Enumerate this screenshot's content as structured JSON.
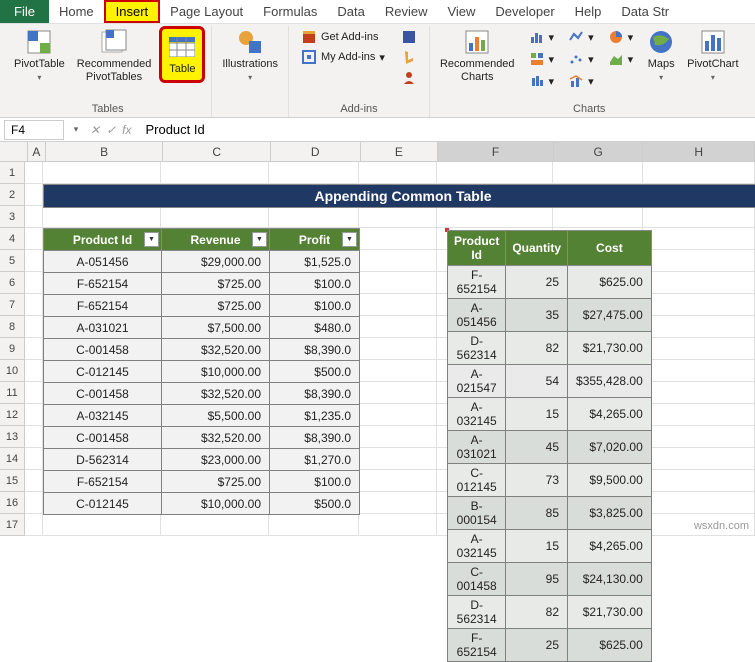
{
  "tabs": {
    "file": "File",
    "home": "Home",
    "insert": "Insert",
    "page_layout": "Page Layout",
    "formulas": "Formulas",
    "data": "Data",
    "review": "Review",
    "view": "View",
    "developer": "Developer",
    "help": "Help",
    "data_str": "Data Str"
  },
  "ribbon": {
    "pivot": "PivotTable",
    "recommended_pivot": "Recommended\nPivotTables",
    "table": "Table",
    "illustrations": "Illustrations",
    "get_addins": "Get Add-ins",
    "my_addins": "My Add-ins",
    "recommended_charts": "Recommended\nCharts",
    "maps": "Maps",
    "pivotchart": "PivotChart",
    "group_tables": "Tables",
    "group_addins": "Add-ins",
    "group_charts": "Charts"
  },
  "formula": {
    "cell_ref": "F4",
    "value": "Product Id"
  },
  "cols": [
    "A",
    "B",
    "C",
    "D",
    "E",
    "F",
    "G",
    "H"
  ],
  "rows": [
    "1",
    "2",
    "3",
    "4",
    "5",
    "6",
    "7",
    "8",
    "9",
    "10",
    "11",
    "12",
    "13",
    "14",
    "15",
    "16",
    "17"
  ],
  "title": "Appending Common Table",
  "table1": {
    "headers": [
      "Product Id",
      "Revenue",
      "Profit"
    ],
    "rows": [
      [
        "A-051456",
        "$29,000.00",
        "$1,525.0"
      ],
      [
        "F-652154",
        "$725.00",
        "$100.0"
      ],
      [
        "F-652154",
        "$725.00",
        "$100.0"
      ],
      [
        "A-031021",
        "$7,500.00",
        "$480.0"
      ],
      [
        "C-001458",
        "$32,520.00",
        "$8,390.0"
      ],
      [
        "C-012145",
        "$10,000.00",
        "$500.0"
      ],
      [
        "C-001458",
        "$32,520.00",
        "$8,390.0"
      ],
      [
        "A-032145",
        "$5,500.00",
        "$1,235.0"
      ],
      [
        "C-001458",
        "$32,520.00",
        "$8,390.0"
      ],
      [
        "D-562314",
        "$23,000.00",
        "$1,270.0"
      ],
      [
        "F-652154",
        "$725.00",
        "$100.0"
      ],
      [
        "C-012145",
        "$10,000.00",
        "$500.0"
      ]
    ]
  },
  "table2": {
    "headers": [
      "Product Id",
      "Quantity",
      "Cost"
    ],
    "rows": [
      [
        "F-652154",
        "25",
        "$625.00"
      ],
      [
        "A-051456",
        "35",
        "$27,475.00"
      ],
      [
        "D-562314",
        "82",
        "$21,730.00"
      ],
      [
        "A-021547",
        "54",
        "$355,428.00"
      ],
      [
        "A-032145",
        "15",
        "$4,265.00"
      ],
      [
        "A-031021",
        "45",
        "$7,020.00"
      ],
      [
        "C-012145",
        "73",
        "$9,500.00"
      ],
      [
        "B-000154",
        "85",
        "$3,825.00"
      ],
      [
        "A-032145",
        "15",
        "$4,265.00"
      ],
      [
        "C-001458",
        "95",
        "$24,130.00"
      ],
      [
        "D-562314",
        "82",
        "$21,730.00"
      ],
      [
        "F-652154",
        "25",
        "$625.00"
      ]
    ]
  },
  "watermark": "wsxdn.com"
}
